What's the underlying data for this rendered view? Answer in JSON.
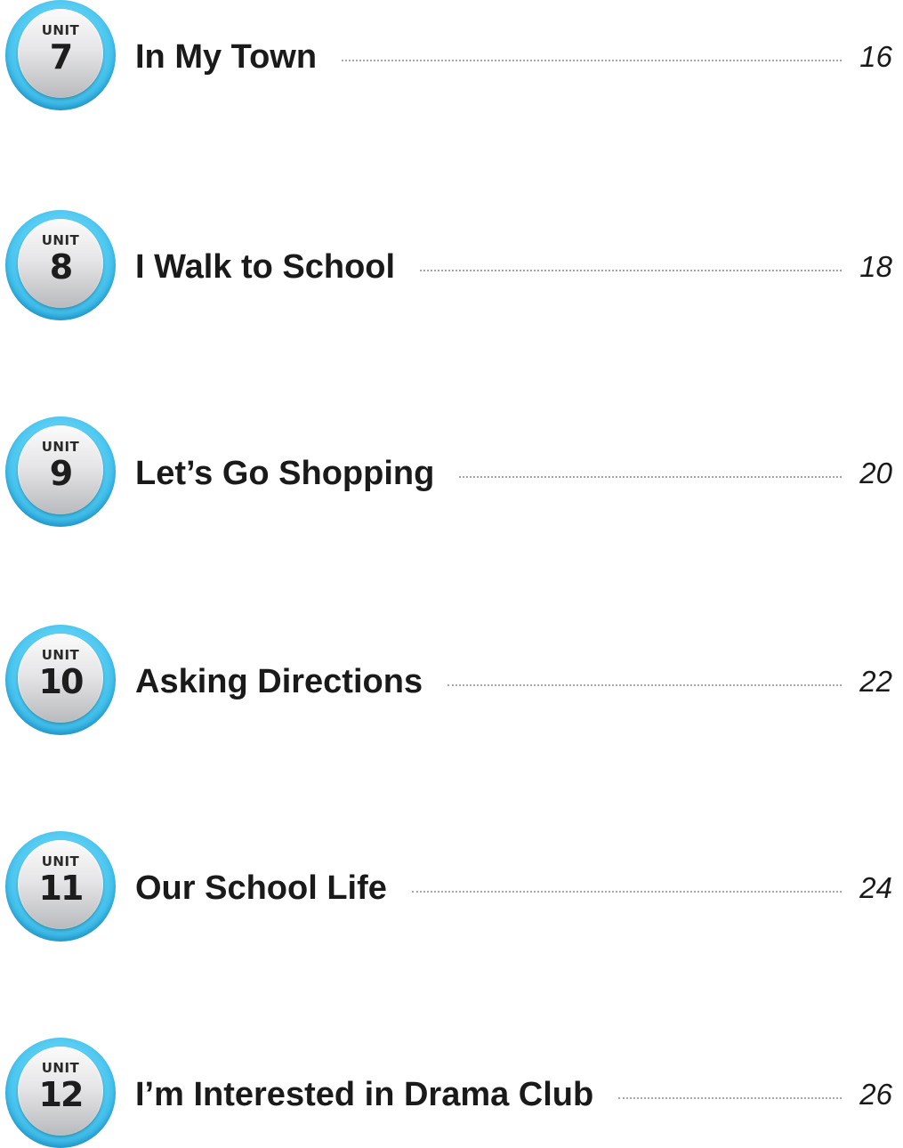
{
  "units": [
    {
      "label": "UNIT",
      "number": "7",
      "title": "In My Town",
      "page": "16"
    },
    {
      "label": "UNIT",
      "number": "8",
      "title": "I Walk to School",
      "page": "18"
    },
    {
      "label": "UNIT",
      "number": "9",
      "title": "Let’s Go Shopping",
      "page": "20"
    },
    {
      "label": "UNIT",
      "number": "10",
      "title": "Asking Directions",
      "page": "22"
    },
    {
      "label": "UNIT",
      "number": "11",
      "title": "Our School Life",
      "page": "24"
    },
    {
      "label": "UNIT",
      "number": "12",
      "title": "I’m Interested in Drama Club",
      "page": "26"
    }
  ],
  "colors": {
    "badge_ring": "#4cc7f0",
    "badge_face": "#d9d9db",
    "text": "#1a1a1a",
    "leader": "#a8a8a8"
  }
}
